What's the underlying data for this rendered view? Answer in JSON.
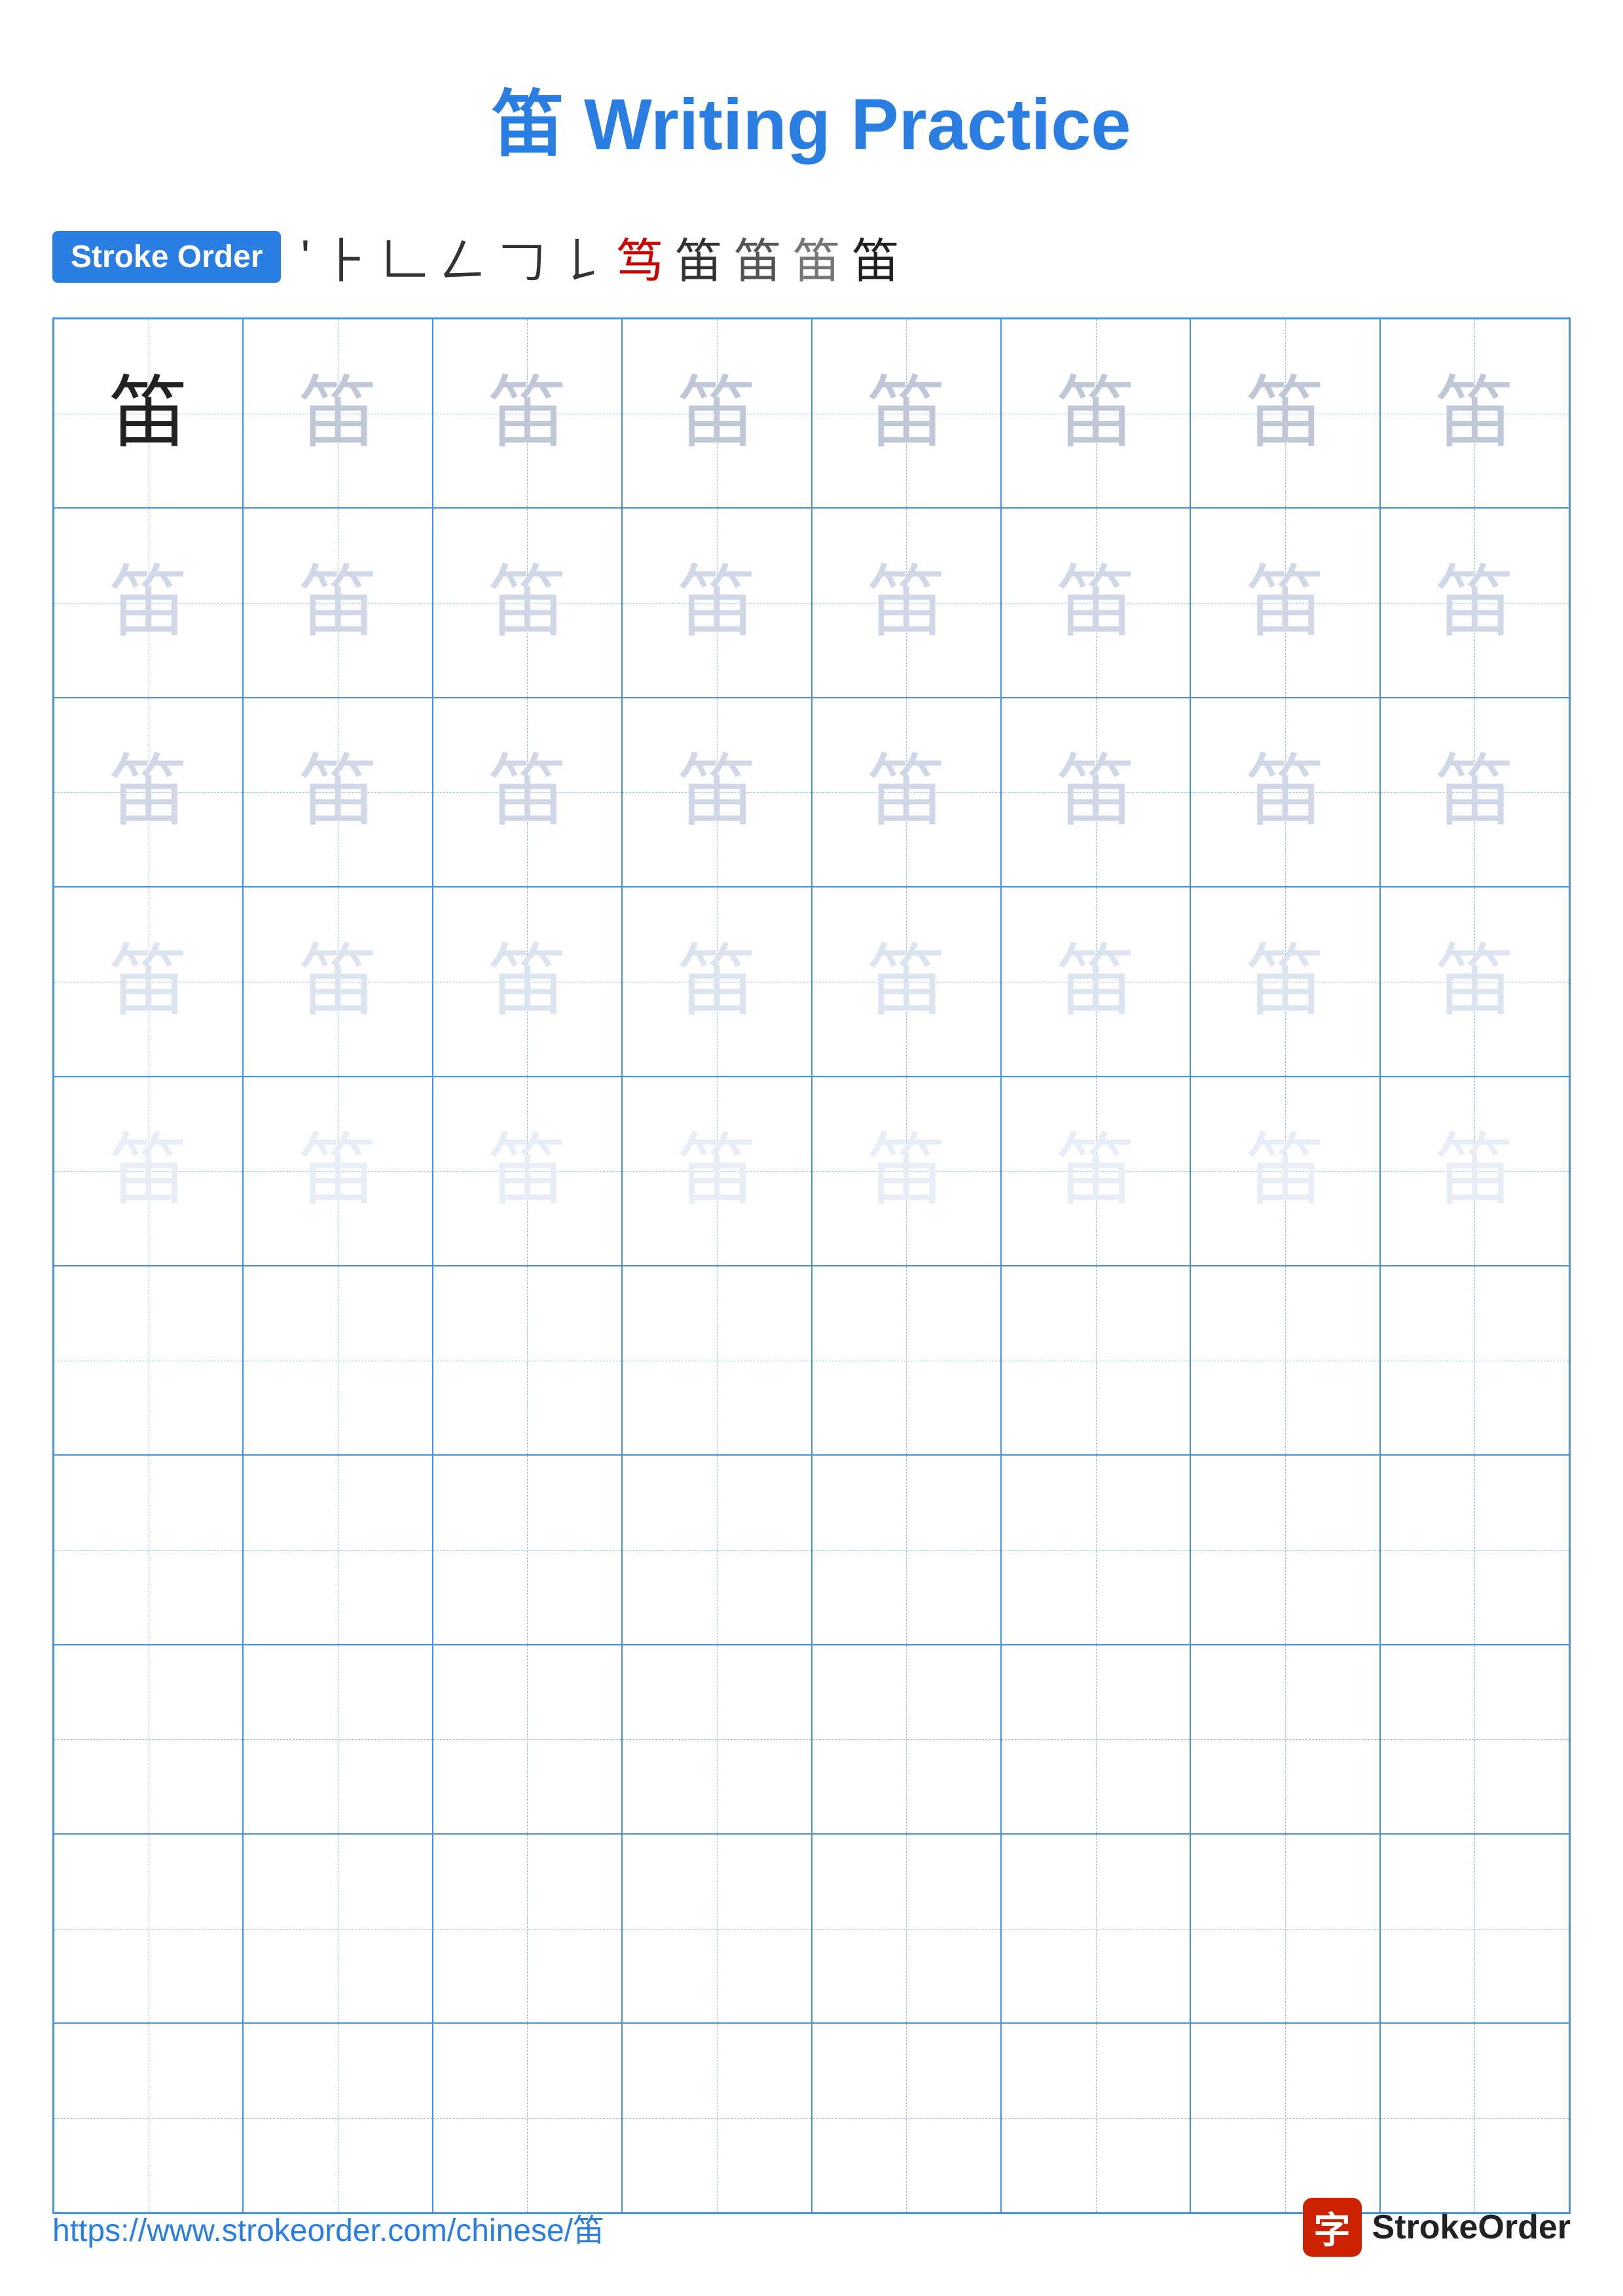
{
  "header": {
    "title": "笛 Writing Practice",
    "char": "笛"
  },
  "stroke_order": {
    "badge_label": "Stroke Order",
    "strokes": [
      "'",
      "ㄱ",
      "ㄷ",
      "ㄲ",
      "ㄲㄱ",
      "ㄲㄲ",
      "笃",
      "笛",
      "笛",
      "笛",
      "笛"
    ]
  },
  "grid": {
    "rows": 10,
    "cols": 8,
    "char": "笛"
  },
  "footer": {
    "url": "https://www.strokeorder.com/chinese/笛",
    "logo_char": "字",
    "logo_text": "StrokeOrder"
  }
}
